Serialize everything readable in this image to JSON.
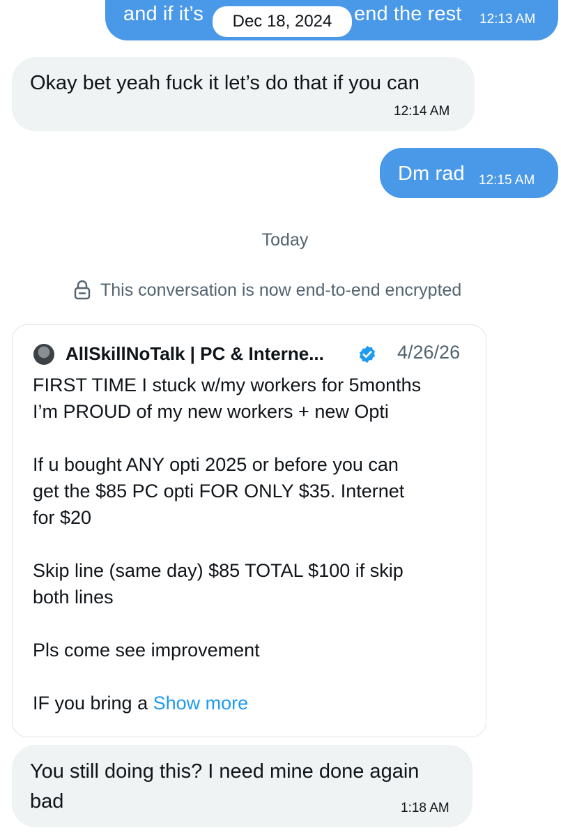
{
  "messages": {
    "m1": {
      "text_left": "and if it’s",
      "text_right": "end the rest",
      "time": "12:13 AM"
    },
    "date_pill": "Dec 18, 2024",
    "m2": {
      "text": "Okay bet yeah fuck it let’s do that if you can",
      "time": "12:14 AM"
    },
    "m3": {
      "text": "Dm rad",
      "time": "12:15 AM"
    },
    "separator": "Today",
    "encryption_notice": "This conversation is now end-to-end encrypted",
    "shared_post": {
      "author": "AllSkillNoTalk | PC & Interne...",
      "date": "4/26/26",
      "lines": [
        "FIRST TIME I stuck w/my workers for 5months",
        "I’m PROUD of my new workers + new Opti",
        "If u bought ANY opti 2025 or before you can",
        "get the $85 PC opti FOR ONLY $35. Internet",
        "for $20",
        "Skip line (same day) $85 TOTAL $100 if skip",
        "both lines",
        "Pls come see improvement",
        "IF you bring a"
      ],
      "show_more": "Show more"
    },
    "m4": {
      "line1": "You still doing this? I need mine done again",
      "line2": "bad",
      "time": "1:18 AM"
    }
  },
  "colors": {
    "outgoing": "#4a99e9",
    "incoming": "#eff3f4",
    "link": "#1d9bf0",
    "verified": "#1d9bf0"
  }
}
